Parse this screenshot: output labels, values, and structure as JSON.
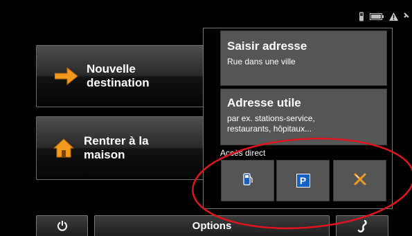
{
  "status_icons": [
    "phone-icon",
    "battery-icon",
    "warning-icon",
    "satellite-icon"
  ],
  "main_buttons": {
    "new_destination": {
      "label": "Nouvelle\ndestination",
      "icon": "arrow-right-icon"
    },
    "go_home": {
      "label": "Rentrer à la\nmaison",
      "icon": "home-icon"
    }
  },
  "panel": {
    "enter_address": {
      "title": "Saisir adresse",
      "subtitle": "Rue dans une ville"
    },
    "useful_address": {
      "title": "Adresse utile",
      "subtitle": "par ex. stations-service,\nrestaurants, hôpitaux..."
    },
    "direct_access_label": "Accès direct",
    "quick_access": [
      {
        "name": "fuel-station",
        "icon": "fuel-pump-icon"
      },
      {
        "name": "parking",
        "icon": "parking-icon",
        "glyph": "P"
      },
      {
        "name": "restaurant",
        "icon": "fork-knife-icon"
      }
    ]
  },
  "bottom_bar": {
    "power_icon": "power-icon",
    "options_label": "Options",
    "phone_icon": "phone-handset-icon"
  },
  "colors": {
    "background": "#000000",
    "tile_gray": "#555555",
    "accent_orange": "#f39a1e",
    "parking_blue": "#1560c8",
    "annotation_red": "#e0141e"
  }
}
